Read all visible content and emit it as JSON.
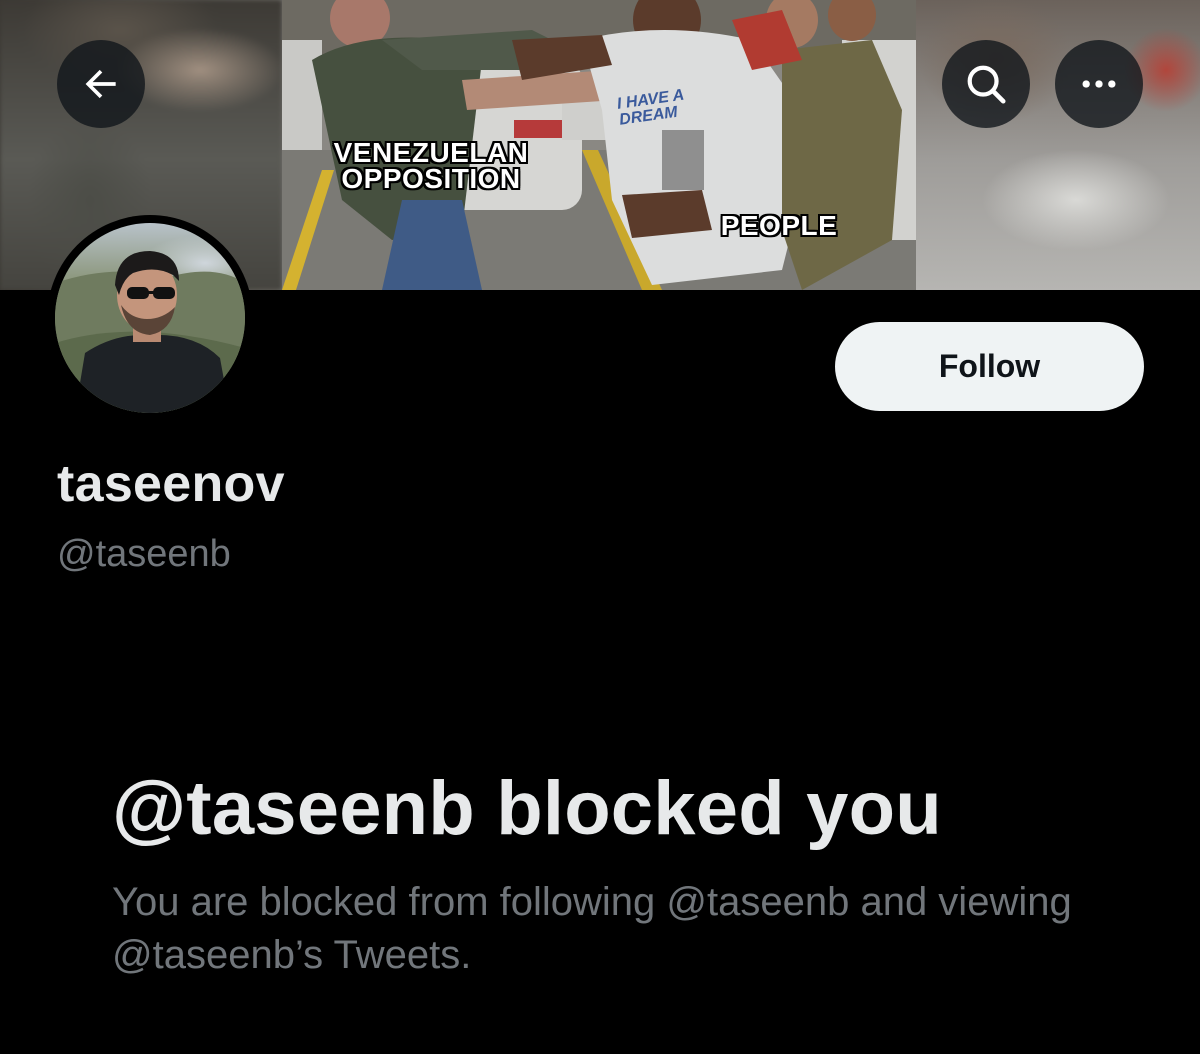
{
  "header": {
    "back_icon": "arrow-left-icon",
    "search_icon": "search-icon",
    "more_icon": "more-horizontal-icon",
    "banner": {
      "caption_left_line1": "VENEZUELAN",
      "caption_left_line2": "OPPOSITION",
      "caption_right": "PEOPLE",
      "shirt_text_line1": "I HAVE A",
      "shirt_text_line2": "DREAM"
    }
  },
  "profile": {
    "display_name": "taseenov",
    "handle": "@taseenb",
    "follow_label": "Follow"
  },
  "blocked": {
    "title": "@taseenb blocked you",
    "body": "You are blocked from following @taseenb and viewing @taseenb’s Tweets."
  },
  "colors": {
    "background": "#000000",
    "primary_text": "#e7e9ea",
    "secondary_text": "#71767b",
    "follow_button_bg": "#eff3f4",
    "follow_button_text": "#0f1419"
  }
}
